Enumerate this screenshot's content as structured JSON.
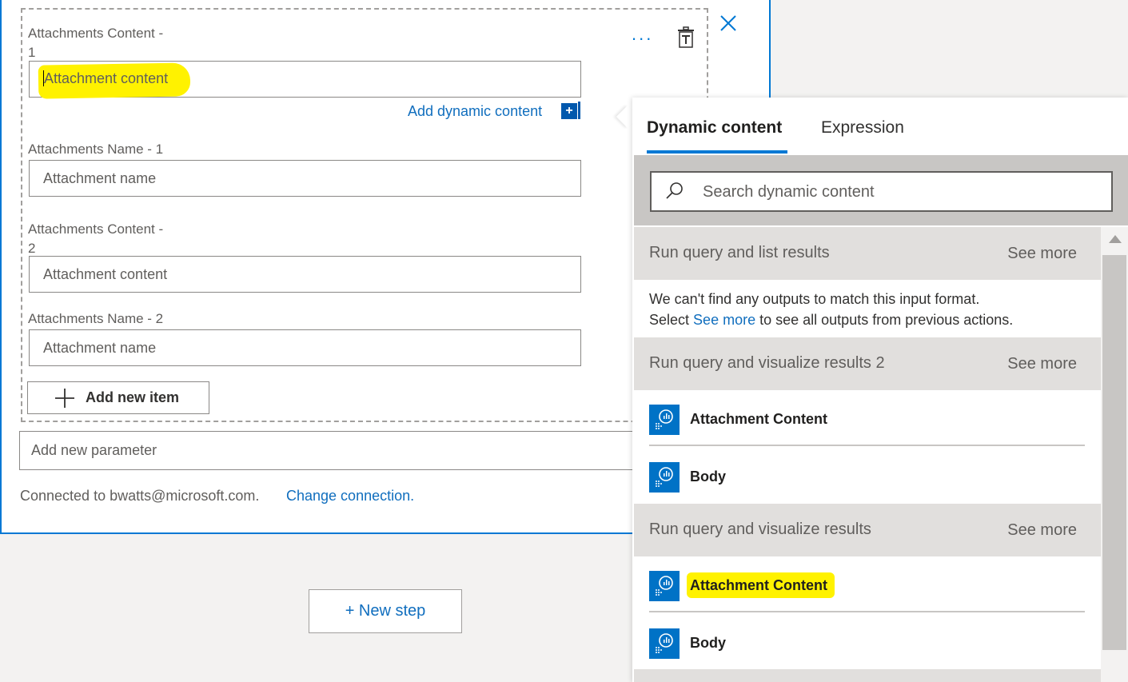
{
  "card": {
    "fields": [
      {
        "label_line1": "Attachments Content -",
        "label_line2": "1",
        "value": "Attachment content"
      },
      {
        "label": "Attachments Name - 1",
        "placeholder": "Attachment name"
      },
      {
        "label_line1": "Attachments Content -",
        "label_line2": "2",
        "placeholder": "Attachment content"
      },
      {
        "label": "Attachments Name - 2",
        "placeholder": "Attachment name"
      }
    ],
    "add_dynamic_label": "Add dynamic content",
    "add_dynamic_plus": "+",
    "more_label": "...",
    "add_item_label": "Add new item",
    "add_param_placeholder": "Add new parameter",
    "connected_text": "Connected to bwatts@microsoft.com.",
    "change_connection": "Change connection."
  },
  "new_step_label": "+ New step",
  "panel": {
    "tabs": [
      "Dynamic content",
      "Expression"
    ],
    "search_placeholder": "Search dynamic content",
    "sections": [
      {
        "title": "Run query and list results",
        "see_more": "See more",
        "message_line1": "We can't find any outputs to match this input format.",
        "message_pre": "Select",
        "message_link": "See more",
        "message_post": "to see all outputs from previous actions."
      },
      {
        "title": "Run query and visualize results 2",
        "see_more": "See more",
        "items": [
          "Attachment Content",
          "Body"
        ]
      },
      {
        "title": "Run query and visualize results",
        "see_more": "See more",
        "items": [
          "Attachment Content",
          "Body"
        ]
      }
    ]
  },
  "colors": {
    "accent": "#0078d4",
    "highlight": "#fff200",
    "link": "#106ebe",
    "icon_bg": "#0072c6"
  },
  "icons": [
    "more-icon",
    "delete-icon",
    "close-icon",
    "plus-icon",
    "search-icon",
    "kusto-icon",
    "scroll-up-icon"
  ]
}
